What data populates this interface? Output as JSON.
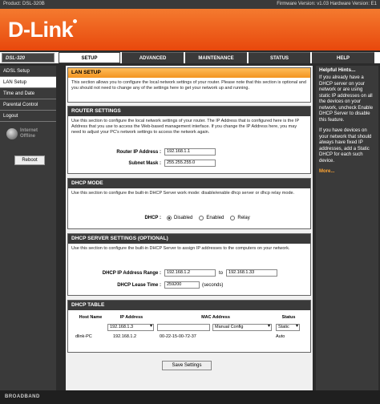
{
  "topbar": {
    "product": "Product: DSL-320B",
    "firmware": "Firmware Version: v1.03 Hardware Version: E1"
  },
  "brand": {
    "logo_text": "D-Link",
    "model": "DSL-320"
  },
  "tabs": [
    {
      "label": "SETUP",
      "active": true
    },
    {
      "label": "ADVANCED",
      "active": false
    },
    {
      "label": "MAINTENANCE",
      "active": false
    },
    {
      "label": "STATUS",
      "active": false
    },
    {
      "label": "HELP",
      "active": false
    }
  ],
  "sidebar": {
    "items": [
      "ADSL Setup",
      "LAN Setup",
      "Time and Date",
      "Parental Control",
      "Logout"
    ],
    "active_index": 1,
    "status_line1": "Internet",
    "status_line2": "Offline",
    "reboot_label": "Reboot"
  },
  "lan_setup": {
    "title": "LAN SETUP",
    "desc": "This section allows you to configure the local network settings of your router. Please note that this section is optional and you should not need to change any of the settings here to get your network up and running."
  },
  "router_settings": {
    "title": "ROUTER SETTINGS",
    "desc": "Use this section to configure the local network settings of your router. The IP Address that is configured here is the IP Address that you use to access the Web-based management interface. If you change the IP Address here, you may need to adjust your PC's network settings to access the network again.",
    "ip_label": "Router IP Address :",
    "ip_value": "192.168.1.1",
    "mask_label": "Subnet Mask :",
    "mask_value": "255.255.255.0"
  },
  "dhcp_mode": {
    "title": "DHCP MODE",
    "desc": "Use this section to configure the built-in DHCP Server work mode: disable/enable dhcp server or dhcp relay mode.",
    "label": "DHCP :",
    "options": [
      "Disabled",
      "Enabled",
      "Relay"
    ],
    "selected": "Disabled"
  },
  "dhcp_server": {
    "title": "DHCP SERVER SETTINGS (OPTIONAL)",
    "desc": "Use this section to configure the built-in DHCP Server to assign IP addresses to the computers on your network.",
    "range_label": "DHCP IP Address Range :",
    "range_start": "192.168.1.2",
    "range_to": "to",
    "range_end": "192.168.1.33",
    "lease_label": "DHCP Lease Time :",
    "lease_value": "259200",
    "lease_unit": "(seconds)"
  },
  "dhcp_table": {
    "title": "DHCP TABLE",
    "headers": [
      "Host Name",
      "IP Address",
      "MAC Address",
      "Status"
    ],
    "input_row": {
      "ip": "192.168.1.3",
      "mac": "",
      "config": "Manual Config",
      "status": "Static"
    },
    "rows": [
      {
        "host": "dlink-PC",
        "ip": "192.168.1.2",
        "mac": "00-22-15-00-72-37",
        "status": "Auto"
      }
    ]
  },
  "save_label": "Save Settings",
  "hints": {
    "title": "Helpful Hints...",
    "p1": "If you already have a DHCP server on your network or are using static IP addresses on all the devices on your network, uncheck Enable DHCP Server to disable this feature.",
    "p2": "If you have devices on your network that should always have fixed IP addresses, add a Static DHCP for each such device.",
    "more": "More..."
  },
  "footer": "BROADBAND"
}
